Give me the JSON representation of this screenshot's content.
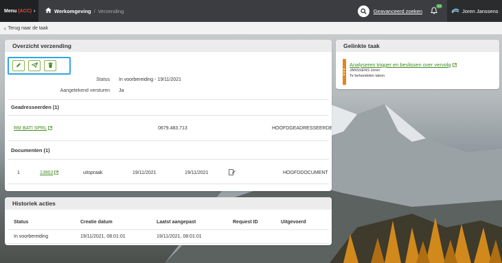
{
  "topbar": {
    "menu_label": "Menu",
    "env_label": "(ACC)",
    "crumb_home": "Werkomgeving",
    "crumb_separator": "/",
    "crumb_current": "Verzending",
    "advanced_search": "Geavanceerd zoeken",
    "notification_count": "14",
    "user_name": "Joren Janssens"
  },
  "subbar": {
    "back_label": "Terug naar de taak"
  },
  "overview": {
    "title": "Overzicht verzending",
    "fields": [
      {
        "label": "Status",
        "value": "In voorbereiding - 19/11/2021"
      },
      {
        "label": "Aangetekend versturen",
        "value": "Ja"
      }
    ],
    "addressees_title": "Geadresseerden (1)",
    "addressee": {
      "name": "RM BATI SPRL",
      "number": "0679.483.713",
      "role": "HOOFDGEADRESSEERDE"
    },
    "documents_title": "Documenten (1)",
    "document": {
      "index": "1",
      "id": "13902",
      "type": "uitspraak",
      "date1": "19/11/2021",
      "date2": "19/11/2021",
      "kind": "HOOFDDOCUMENT"
    }
  },
  "linked_task": {
    "title": "Gelinkte taak",
    "task_link": "Analyseren trigger en beslissen over vervolg",
    "assignee": "JANSSENS Joren",
    "state": "Te behandelen taken"
  },
  "history": {
    "title": "Historiek acties",
    "columns": [
      "Status",
      "Creatie datum",
      "Laatst aangepast",
      "Request ID",
      "Uitgevoerd"
    ],
    "rows": [
      [
        "In voorbereiding",
        "19/11/2021, 08:01:01",
        "19/11/2021, 08:01:01",
        "",
        ""
      ]
    ]
  },
  "colors": {
    "accent_green": "#3f8a1e",
    "highlight_blue": "#2ea7e0",
    "task_orange": "#e3861e",
    "env_red": "#e04a3a"
  }
}
